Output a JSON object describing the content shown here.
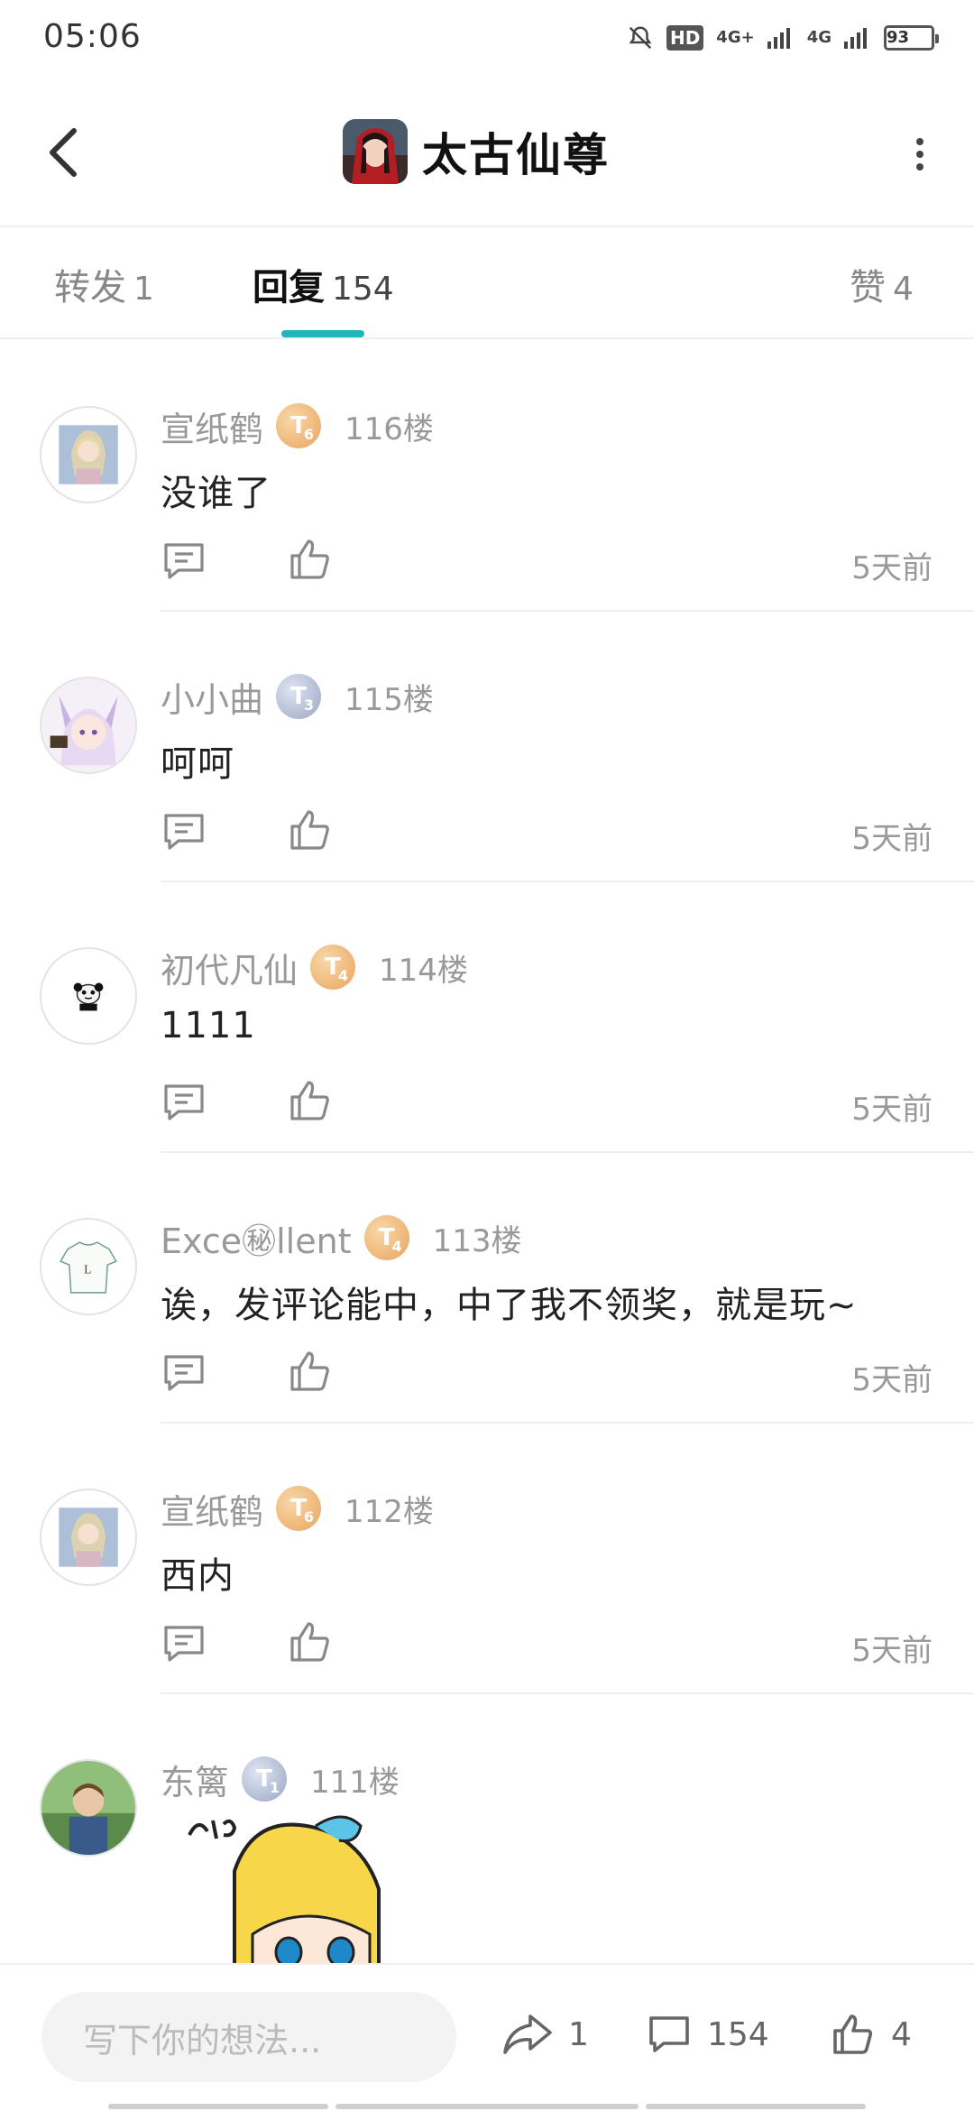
{
  "status_bar": {
    "time": "05:06",
    "hd": "HD",
    "net1": "4G+",
    "net2": "4G",
    "battery": "93"
  },
  "header": {
    "title": "太古仙尊",
    "back_icon": "chevron-left-icon",
    "more_icon": "more-vertical-icon"
  },
  "tabs": [
    {
      "label": "转发",
      "count": "1"
    },
    {
      "label": "回复",
      "count": "154",
      "active": true
    },
    {
      "label": "赞",
      "count": "4"
    }
  ],
  "replies": [
    {
      "username": "宣纸鹤",
      "level": "6",
      "level_color": "gold",
      "floor": "116楼",
      "content": "没谁了",
      "time": "5天前"
    },
    {
      "username": "小小曲",
      "level": "3",
      "level_color": "silver",
      "floor": "115楼",
      "content": "呵呵",
      "time": "5天前"
    },
    {
      "username": "初代凡仙",
      "level": "4",
      "level_color": "gold",
      "floor": "114楼",
      "content": "1111",
      "time": "5天前"
    },
    {
      "username": "Exce㊙llent",
      "level": "4",
      "level_color": "gold",
      "floor": "113楼",
      "content": "诶，发评论能中，中了我不领奖，就是玩~",
      "time": "5天前"
    },
    {
      "username": "宣纸鹤",
      "level": "6",
      "level_color": "gold",
      "floor": "112楼",
      "content": "西内",
      "time": "5天前"
    },
    {
      "username": "东篱",
      "level": "1",
      "level_color": "silver",
      "floor": "111楼",
      "content": "",
      "time": ""
    }
  ],
  "bottom_bar": {
    "placeholder": "写下你的想法...",
    "share_count": "1",
    "comment_count": "154",
    "like_count": "4"
  },
  "colors": {
    "accent": "#1fb7ba",
    "gold_badge": "#e9a55f",
    "silver_badge": "#9aa6c4"
  }
}
